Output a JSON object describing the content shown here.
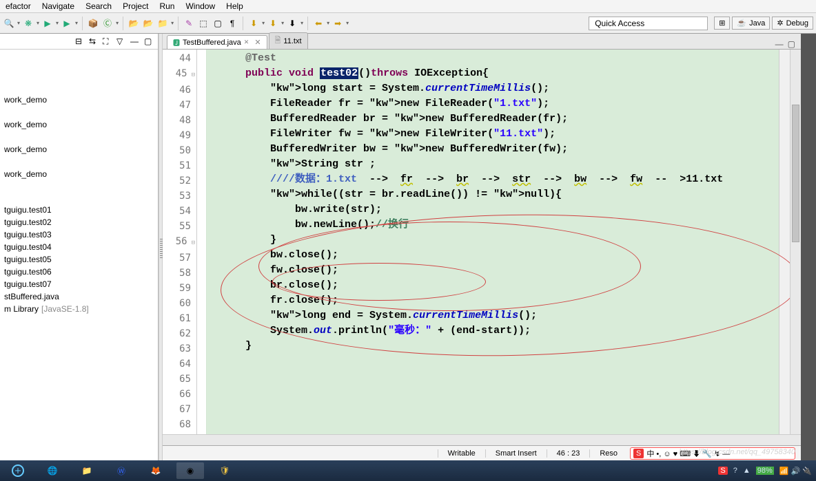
{
  "menu": {
    "items": [
      "efactor",
      "Navigate",
      "Search",
      "Project",
      "Run",
      "Window",
      "Help"
    ]
  },
  "quickAccess": "Quick Access",
  "perspectives": {
    "java": "Java",
    "debug": "Debug"
  },
  "sidebar": {
    "items": [
      {
        "label": "work_demo"
      },
      {
        "label": "work_demo"
      },
      {
        "label": "work_demo"
      },
      {
        "label": "work_demo"
      },
      {
        "label": "tguigu.test01"
      },
      {
        "label": "tguigu.test02"
      },
      {
        "label": "tguigu.test03"
      },
      {
        "label": "tguigu.test04"
      },
      {
        "label": "tguigu.test05"
      },
      {
        "label": "tguigu.test06"
      },
      {
        "label": "tguigu.test07"
      },
      {
        "label": "stBuffered.java"
      }
    ],
    "lib": "m Library",
    "libVer": "[JavaSE-1.8]"
  },
  "tabs": {
    "active": "TestBuffered.java",
    "inactive": "11.txt"
  },
  "gutter": {
    "start": 44,
    "end": 68
  },
  "code": {
    "lines": [
      "",
      "    @Test",
      "    public void test02()throws IOException{",
      "        long start = System.currentTimeMillis();",
      "        FileReader fr = new FileReader(\"1.txt\");",
      "        BufferedReader br = new BufferedReader(fr);",
      "",
      "        FileWriter fw = new FileWriter(\"11.txt\");",
      "        BufferedWriter bw = new BufferedWriter(fw);",
      "",
      "        String str ;",
      "        ////数据：1.txt  -->  fr  -->  br  -->  str  -->  bw  -->  fw  --  >11.txt",
      "        while((str = br.readLine()) != null){",
      "            bw.write(str);",
      "            bw.newLine();//换行",
      "        }",
      "",
      "        bw.close();",
      "        fw.close();",
      "        br.close();",
      "        fr.close();",
      "",
      "        long end = System.currentTimeMillis();",
      "        System.out.println(\"毫秒：\" + (end-start));",
      "    }"
    ],
    "highlight": "test02"
  },
  "status": {
    "writable": "Writable",
    "insert": "Smart Insert",
    "pos": "46 : 23",
    "reso": "Reso"
  },
  "tray": {
    "pct": "98%"
  },
  "watermark": "https://blog.csdn.net/qq_49758340"
}
